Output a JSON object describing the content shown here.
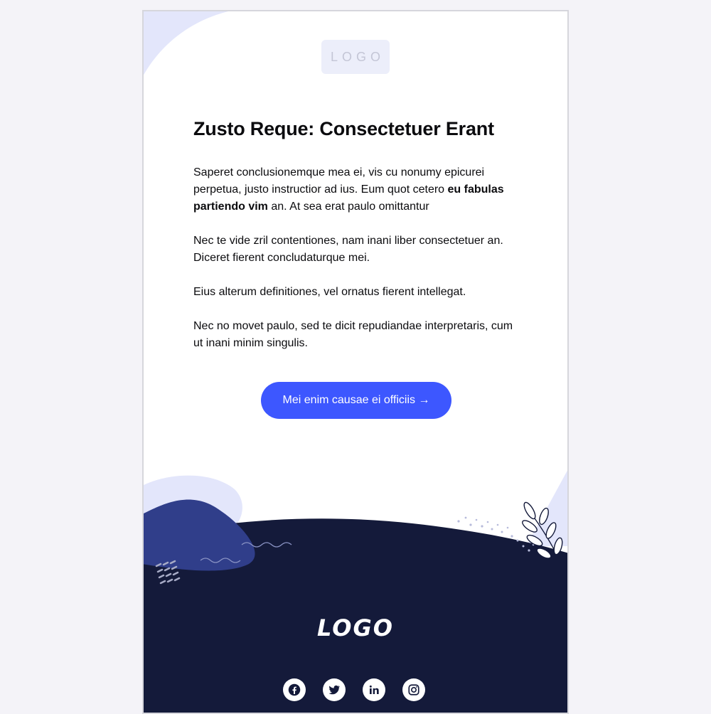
{
  "header": {
    "logo_text": "LOGO"
  },
  "content": {
    "headline": "Zusto Reque: Consectetuer Erant",
    "paragraph_1_start": "Saperet conclusionemque mea ei, vis cu nonumy epicurei perpetua, justo instructior ad ius. Eum quot cetero ",
    "paragraph_1_bold": "eu fabulas partiendo vim",
    "paragraph_1_end": " an. At sea erat paulo omittantur",
    "paragraph_2": "Nec te vide zril contentiones, nam inani liber consectetuer an. Diceret fierent concludaturque mei.",
    "paragraph_3": "Eius alterum definitiones, vel ornatus fierent intellegat.",
    "paragraph_4": "Nec no movet paulo, sed te dicit repudiandae interpretaris, cum ut inani minim singulis.",
    "cta_label": "Mei enim causae ei officiis →"
  },
  "footer": {
    "logo_text": "LOGO",
    "social_icons": [
      "facebook-icon",
      "twitter-icon",
      "linkedin-icon",
      "instagram-icon"
    ]
  },
  "colors": {
    "page_background": "#f4f3f8",
    "accent": "#3d57ff",
    "footer_dark": "#141a3a",
    "blob_light": "#e3e6fb",
    "blob_blue": "#303e8a"
  }
}
